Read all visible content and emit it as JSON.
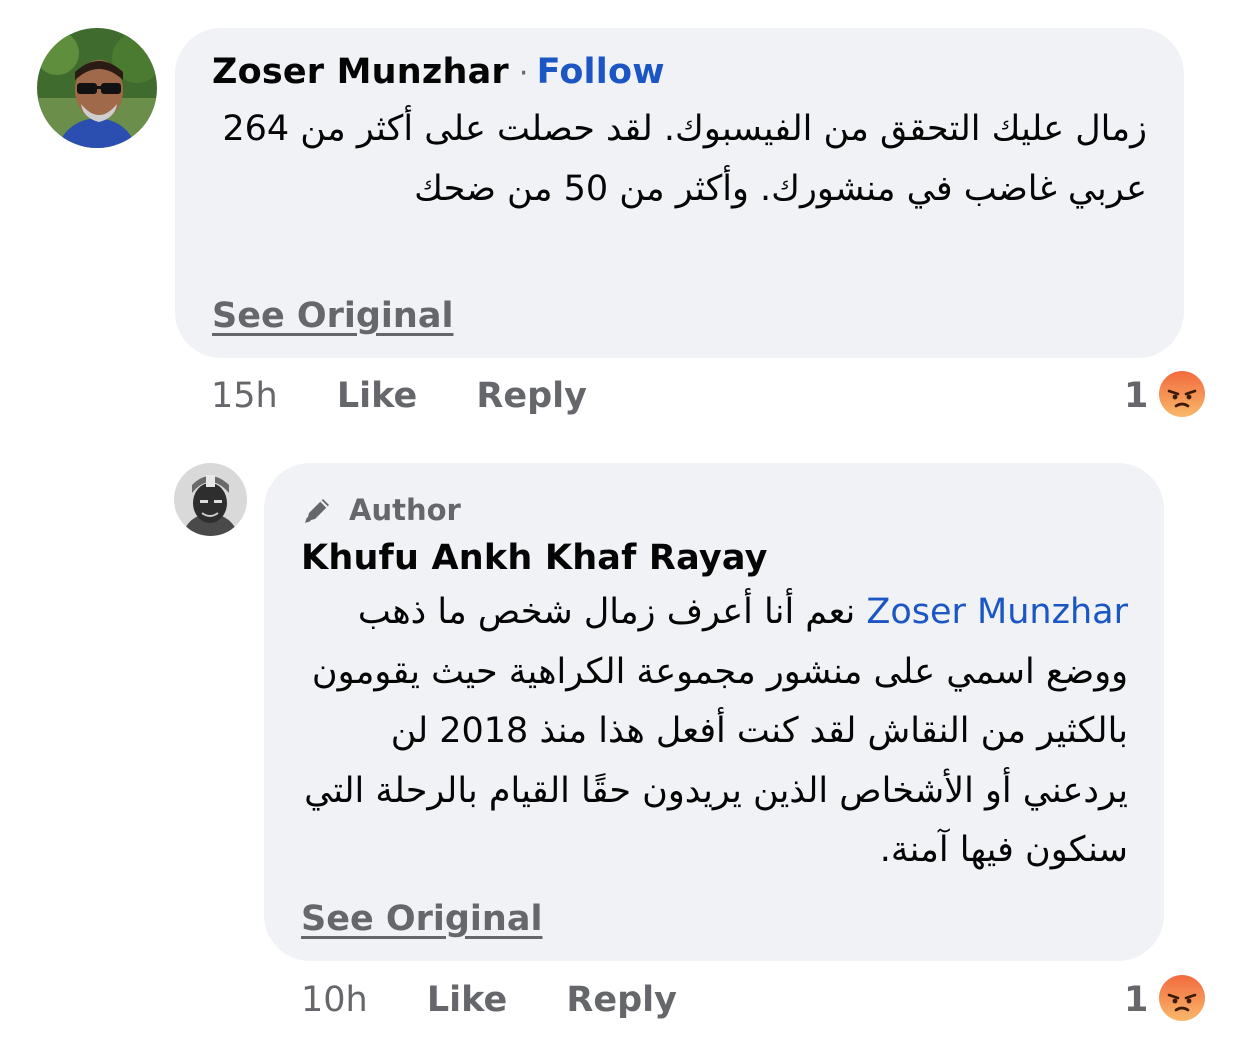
{
  "comments": [
    {
      "author": "Zoser Munzhar",
      "separator": "·",
      "follow_label": "Follow",
      "text": "زمال عليك التحقق من الفيسبوك. لقد حصلت على أكثر من 264 عربي غاضب في منشورك. وأكثر من 50 من ضحك",
      "see_original": "See Original",
      "time": "15h",
      "like_label": "Like",
      "reply_label": "Reply",
      "reaction_count": "1",
      "reaction": "angry-emoji-icon"
    },
    {
      "badge_label": "Author",
      "badge_icon": "pencil-icon",
      "author": "Khufu Ankh Khaf Rayay",
      "mention": "Zoser Munzhar",
      "text": "نعم أنا أعرف زمال شخص ما ذهب ووضع اسمي على منشور مجموعة الكراهية حيث يقومون بالكثير من النقاش لقد كنت أفعل هذا منذ 2018 لن يردعني أو الأشخاص الذين يريدون حقًا القيام بالرحلة التي سنكون فيها آمنة.",
      "see_original": "See Original",
      "time": "10h",
      "like_label": "Like",
      "reply_label": "Reply",
      "reaction_count": "1",
      "reaction": "angry-emoji-icon"
    }
  ],
  "colors": {
    "bubble": "#f0f2f5",
    "link_blue": "#1b56c4",
    "secondary_text": "#65676b",
    "angry_top": "#f36a3e",
    "angry_bottom": "#f8b86a"
  }
}
